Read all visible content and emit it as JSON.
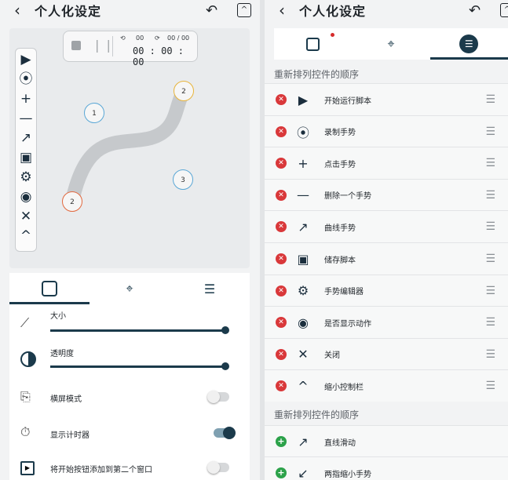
{
  "left": {
    "title": "个人化设定",
    "timer": {
      "loop_count": "00",
      "repeat_count": "00 / 00",
      "time": "00 : 00 : 00"
    },
    "toolbar_icons": [
      "play-icon",
      "record-icon",
      "plus-icon",
      "minus-icon",
      "curve-arrow-icon",
      "save-icon",
      "gear-icon",
      "eye-icon",
      "close-icon",
      "chevron-up-icon"
    ],
    "markers": [
      {
        "label": "1",
        "color": "#5aa7d6"
      },
      {
        "label": "2",
        "color": "#e8b43a"
      },
      {
        "label": "2",
        "color": "#e2693f"
      },
      {
        "label": "3",
        "color": "#5aa7d6"
      }
    ],
    "tabs": [
      "copy-icon",
      "location-icon",
      "sort-icon"
    ],
    "settings": [
      {
        "label": "大小",
        "icon": "ruler-icon",
        "level": 1.0
      },
      {
        "label": "透明度",
        "icon": "contrast-icon",
        "level": 1.0
      },
      {
        "label": "横屏模式",
        "icon": "landscape-icon",
        "on": false
      },
      {
        "label": "显示计时器",
        "icon": "timer-icon",
        "on": true
      },
      {
        "label": "将开始按钮添加到第二个窗口",
        "icon": "play-box-icon",
        "on": false
      }
    ]
  },
  "right": {
    "title": "个人化设定",
    "section1": "重新排列控件的顺序",
    "items": [
      {
        "icon": "play-icon",
        "glyph": "▶",
        "label": "开始运行脚本"
      },
      {
        "icon": "record-icon",
        "glyph": "⦿",
        "label": "录制手势"
      },
      {
        "icon": "plus-icon",
        "glyph": "+",
        "label": "点击手势"
      },
      {
        "icon": "minus-icon",
        "glyph": "—",
        "label": "删除一个手势"
      },
      {
        "icon": "curve-arrow-icon",
        "glyph": "↗",
        "label": "曲线手势"
      },
      {
        "icon": "save-icon",
        "glyph": "▣",
        "label": "储存脚本"
      },
      {
        "icon": "gear-icon",
        "glyph": "⚙",
        "label": "手势编辑器"
      },
      {
        "icon": "eye-icon",
        "glyph": "◉",
        "label": "是否显示动作"
      },
      {
        "icon": "close-icon",
        "glyph": "✕",
        "label": "关闭"
      },
      {
        "icon": "chevron-up-icon",
        "glyph": "^",
        "label": "缩小控制栏"
      }
    ],
    "section2": "重新排列控件的顺序",
    "extra_items": [
      {
        "icon": "arrow-icon",
        "glyph": "↗",
        "label": "直线滑动"
      },
      {
        "icon": "pinch-icon",
        "glyph": "↙",
        "label": "两指缩小手势"
      }
    ]
  },
  "colors": {
    "primary": "#1b3a4b",
    "delete": "#d9383a",
    "add": "#2ca24a",
    "notification": "#d62b2b"
  }
}
